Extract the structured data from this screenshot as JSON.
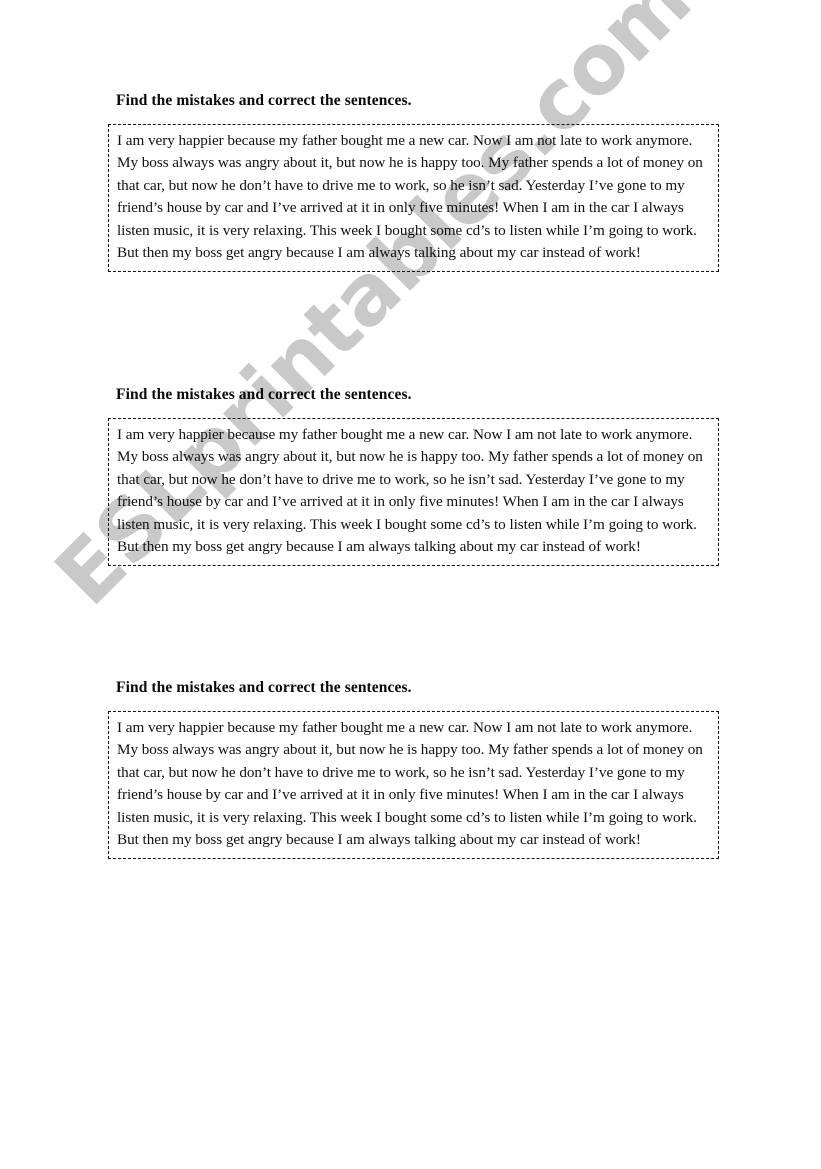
{
  "page": {
    "background_color": "#ffffff",
    "text_color": "#111111"
  },
  "watermark": {
    "text": "ESLprintables.com",
    "color": "#c9c9c9",
    "rotation_degrees": -45
  },
  "worksheet": {
    "heading": "Find the mistakes and correct the sentences.",
    "passage": "I am very happier because my father bought me a new car. Now I am not late to work anymore. My boss always was angry about it, but now he is happy too. My father spends a lot of money on that car, but now he don’t have to drive me to work, so he isn’t sad. Yesterday I’ve gone to my friend’s house by car and I’ve arrived at it in only five minutes! When I am in the car I always listen music, it is very relaxing. This week I bought some cd’s to listen while I’m going to work. But then my boss get angry because I am always talking about my car instead of work!",
    "blocks": [
      {
        "heading": "Find the mistakes and correct the sentences.",
        "passage": "I am very happier because my father bought me a new car. Now I am not late to work anymore. My boss always was angry about it, but now he is happy too. My father spends a lot of money on that car, but now he don’t have to drive me to work, so he isn’t sad. Yesterday I’ve gone to my friend’s house by car and I’ve arrived at it in only five minutes! When I am in the car I always listen music, it is very relaxing. This week I bought some cd’s to listen while I’m going to work. But then my boss get angry because I am always talking about my car instead of work!"
      },
      {
        "heading": "Find the mistakes and correct the sentences.",
        "passage": "I am very happier because my father bought me a new car. Now I am not late to work anymore. My boss always was angry about it, but now he is happy too. My father spends a lot of money on that car, but now he don’t have to drive me to work, so he isn’t sad. Yesterday I’ve gone to my friend’s house by car and I’ve arrived at it in only five minutes! When I am in the car I always listen music, it is very relaxing. This week I bought some cd’s to listen while I’m going to work. But then my boss get angry because I am always talking about my car instead of work!"
      },
      {
        "heading": "Find the mistakes and correct the sentences.",
        "passage": "I am very happier because my father bought me a new car. Now I am not late to work anymore. My boss always was angry about it, but now he is happy too. My father spends a lot of money on that car, but now he don’t have to drive me to work, so he isn’t sad. Yesterday I’ve gone to my friend’s house by car and I’ve arrived at it in only five minutes! When I am in the car I always listen music, it is very relaxing. This week I bought some cd’s to listen while I’m going to work. But then my boss get angry because I am always talking about my car instead of work!"
      }
    ]
  }
}
